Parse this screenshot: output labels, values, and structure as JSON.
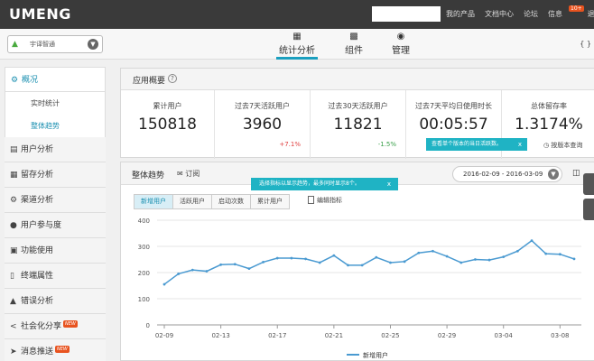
{
  "topbar": {
    "logo": "UMENG",
    "links": [
      "我的产品",
      "文档中心",
      "论坛",
      "信息",
      "退出"
    ],
    "badge": "10+"
  },
  "app_selector": {
    "name": "宇译智通"
  },
  "nav_tabs": [
    {
      "label": "统计分析",
      "icon": "bar-chart-icon",
      "active": true
    },
    {
      "label": "组件",
      "icon": "grid-icon",
      "active": false
    },
    {
      "label": "管理",
      "icon": "car-icon",
      "active": false
    }
  ],
  "sidebar": {
    "overview": "概况",
    "sub": [
      "实时统计",
      "整体趋势"
    ],
    "items": [
      {
        "label": "用户分析",
        "icon": "bar-chart-icon"
      },
      {
        "label": "留存分析",
        "icon": "retention-icon"
      },
      {
        "label": "渠道分析",
        "icon": "channel-icon"
      },
      {
        "label": "用户参与度",
        "icon": "user-icon"
      },
      {
        "label": "功能使用",
        "icon": "function-icon"
      },
      {
        "label": "终端属性",
        "icon": "device-icon"
      },
      {
        "label": "错误分析",
        "icon": "warning-icon"
      },
      {
        "label": "社会化分享",
        "icon": "share-icon",
        "new": "NEW"
      },
      {
        "label": "消息推送",
        "icon": "push-icon",
        "new": "NEW"
      }
    ]
  },
  "overview_panel": {
    "title": "应用概要",
    "stats": [
      {
        "label": "累计用户",
        "value": "150818",
        "change": ""
      },
      {
        "label": "过去7天活跃用户",
        "value": "3960",
        "change": "+7.1%"
      },
      {
        "label": "过去30天活跃用户",
        "value": "11821",
        "change": "-1.5%"
      },
      {
        "label": "过去7天平均日使用时长",
        "value": "00:05:57",
        "change": ""
      },
      {
        "label": "总体留存率",
        "value": "1.3174%",
        "change": ""
      }
    ],
    "tooltip": "查看单个版本的当日活跃数。",
    "adjust_link": "按版本查询"
  },
  "trend_panel": {
    "title": "整体趋势",
    "download": "订阅",
    "date_range": "2016-02-09 - 2016-03-09",
    "tooltip": "选择指标以显示趋势，最多同时显示8个。",
    "metric_tabs": [
      "新增用户",
      "活跃用户",
      "启动次数",
      "累计用户"
    ],
    "edit_label": "编辑指标"
  },
  "chart_data": {
    "type": "line",
    "series": [
      {
        "name": "新增用户",
        "values": [
          155,
          195,
          210,
          205,
          230,
          232,
          215,
          240,
          255,
          255,
          252,
          238,
          265,
          228,
          228,
          258,
          238,
          242,
          275,
          282,
          262,
          238,
          250,
          248,
          260,
          282,
          322,
          272,
          270,
          252
        ]
      }
    ],
    "x": [
      "02-09",
      "02-10",
      "02-11",
      "02-12",
      "02-13",
      "02-14",
      "02-15",
      "02-16",
      "02-17",
      "02-18",
      "02-19",
      "02-20",
      "02-21",
      "02-22",
      "02-23",
      "02-24",
      "02-25",
      "02-26",
      "02-27",
      "02-28",
      "02-29",
      "03-01",
      "03-02",
      "03-03",
      "03-04",
      "03-05",
      "03-06",
      "03-07",
      "03-08",
      "03-09"
    ],
    "x_ticks": [
      "02-09",
      "02-13",
      "02-17",
      "02-21",
      "02-25",
      "02-29",
      "03-04",
      "03-08"
    ],
    "y_ticks": [
      0,
      100,
      200,
      300,
      400
    ],
    "ylim": [
      0,
      400
    ],
    "legend": "新增用户",
    "color": "#4a9ad1",
    "grid": true
  }
}
